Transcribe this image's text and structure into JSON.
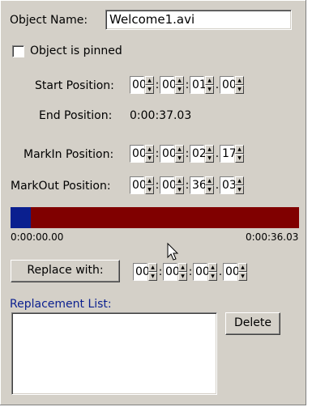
{
  "object_name": {
    "label": "Object Name:",
    "value": "Welcome1.avi"
  },
  "pinned": {
    "label": "Object is pinned",
    "checked": false
  },
  "start_position": {
    "label": "Start Position:",
    "fields": [
      "00",
      "00",
      "01",
      "00"
    ]
  },
  "end_position": {
    "label": "End Position:",
    "value": "0:00:37.03"
  },
  "markin_position": {
    "label": "MarkIn Position:",
    "fields": [
      "00",
      "00",
      "02",
      "17"
    ]
  },
  "markout_position": {
    "label": "MarkOut Position:",
    "fields": [
      "00",
      "00",
      "36",
      "03"
    ]
  },
  "timeline": {
    "start_label": "0:00:00.00",
    "end_label": "0:00:36.03",
    "progress_fraction": 0.07,
    "fill_color": "#0a1f8f",
    "track_color": "#800000"
  },
  "replace": {
    "button_label": "Replace with:",
    "fields": [
      "00",
      "00",
      "00",
      "00"
    ]
  },
  "replacement_list": {
    "label": "Replacement List:",
    "label_color": "#0a1f8f"
  },
  "delete_button": {
    "label": "Delete"
  },
  "separators": [
    ":",
    ":",
    "."
  ]
}
